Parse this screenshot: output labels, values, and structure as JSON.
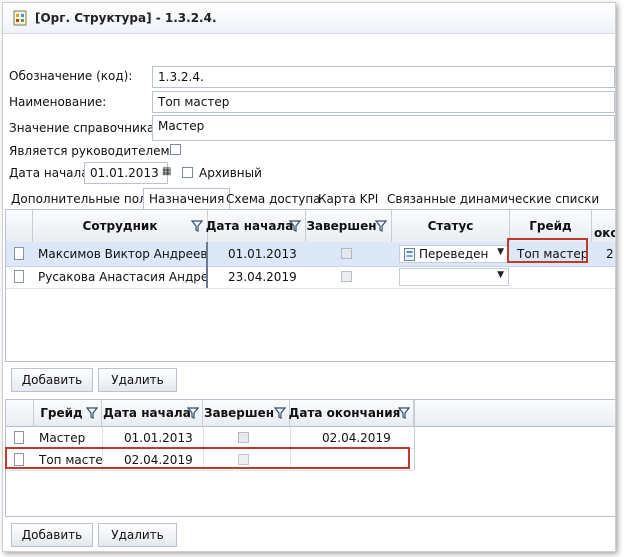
{
  "window": {
    "title": "[Орг. Структура] - 1.3.2.4."
  },
  "form": {
    "code_label": "Обозначение (код):",
    "code_value": "1.3.2.4.",
    "name_label": "Наименование:",
    "name_value": "Топ мастер",
    "ref_label": "Значение справочника:",
    "ref_value": "Мастер",
    "is_head_label": "Является руководителем:",
    "start_label": "Дата начала",
    "start_value": "01.01.2013",
    "archive_label": "Архивный"
  },
  "tabs": [
    "Дополнительные поля",
    "Назначения",
    "Схема доступа",
    "Карта KPI",
    "Связанные динамические списки"
  ],
  "grid1": {
    "headers": {
      "employee": "Сотрудник",
      "start": "Дата начала",
      "done": "Завершен",
      "status": "Статус",
      "grade": "Грейд",
      "end_partial": "око"
    },
    "rows": [
      {
        "employee": "Максимов Виктор Андреевич",
        "start": "01.01.2013",
        "status": "Переведен",
        "grade": "Топ мастер",
        "extra": "2"
      },
      {
        "employee": "Русакова Анастасия Андреевна",
        "start": "23.04.2019",
        "status": "",
        "grade": "",
        "extra": ""
      }
    ]
  },
  "buttons": {
    "add": "Добавить",
    "delete": "Удалить"
  },
  "grid2": {
    "headers": {
      "grade": "Грейд",
      "start": "Дата начала",
      "done": "Завершен",
      "end": "Дата окончания"
    },
    "rows": [
      {
        "grade": "Мастер",
        "start": "01.01.2013",
        "end": "02.04.2019"
      },
      {
        "grade": "Топ мастер",
        "start": "02.04.2019",
        "end": ""
      }
    ]
  },
  "colors": {
    "highlight": "#c0392b",
    "selected_row": "#dce8f7"
  }
}
